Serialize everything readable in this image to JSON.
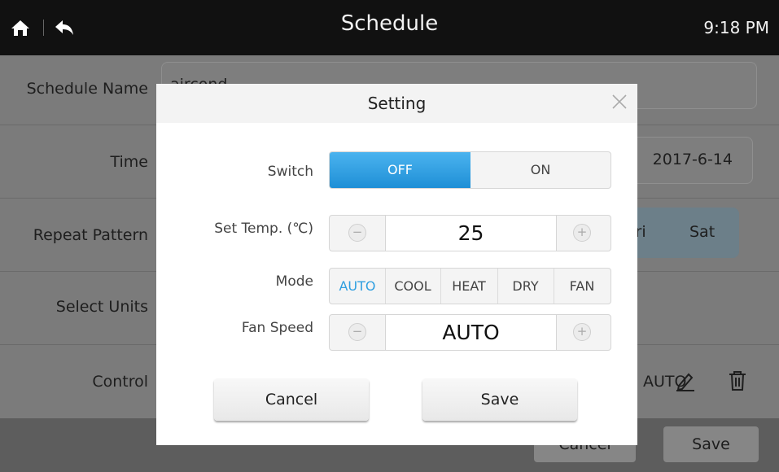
{
  "header": {
    "title": "Schedule",
    "time": "9:18 PM"
  },
  "background": {
    "schedule_name_label": "Schedule Name",
    "schedule_name_value": "aircond",
    "time_label": "Time",
    "date_value": "2017-6-14",
    "repeat_label": "Repeat Pattern",
    "repeat_days": [
      "Fri",
      "Sat"
    ],
    "select_units_label": "Select Units",
    "control_label": "Control",
    "control_value": "AUTO",
    "footer_cancel": "Cancel",
    "footer_save": "Save"
  },
  "dialog": {
    "title": "Setting",
    "switch_label": "Switch",
    "switch_options": [
      "OFF",
      "ON"
    ],
    "switch_selected": "OFF",
    "temp_label": "Set Temp. (℃)",
    "temp_value": "25",
    "mode_label": "Mode",
    "modes": [
      "AUTO",
      "COOL",
      "HEAT",
      "DRY",
      "FAN"
    ],
    "mode_selected": "AUTO",
    "fan_label": "Fan Speed",
    "fan_value": "AUTO",
    "cancel": "Cancel",
    "save": "Save"
  },
  "colors": {
    "accent": "#2f9fe0",
    "header_bg": "#111111"
  }
}
